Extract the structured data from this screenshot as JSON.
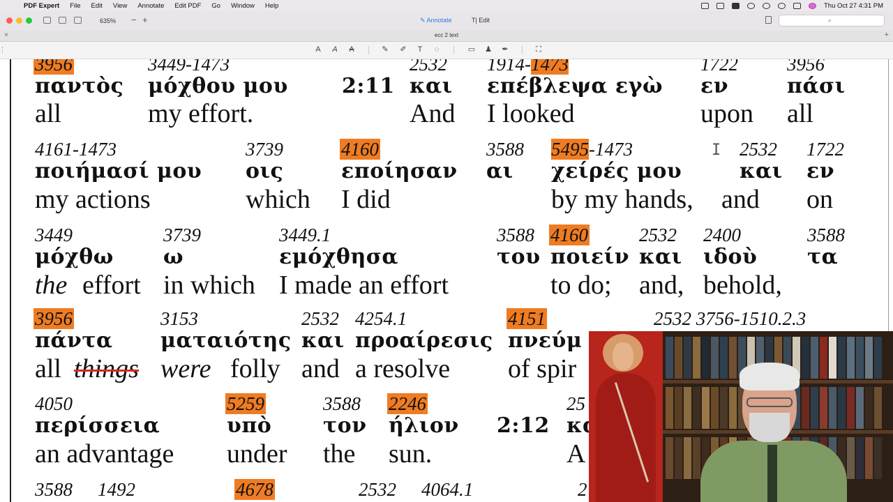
{
  "menubar": {
    "app": "PDF Expert",
    "menus": [
      "File",
      "Edit",
      "View",
      "Annotate",
      "Edit PDF",
      "Go",
      "Window",
      "Help"
    ],
    "clock": "Thu Oct 27  4:31 PM",
    "status_icons": [
      "camera-icon",
      "display-icon",
      "keyboard-us-icon",
      "bluetooth-icon",
      "wifi-icon",
      "search-icon",
      "toggle-icon",
      "siri-icon"
    ]
  },
  "titlebar": {
    "zoom": "635%",
    "zoom_minus": "−",
    "zoom_plus": "+",
    "annotate_label": "Annotate",
    "edit_label": "Edit",
    "search_placeholder": ""
  },
  "tab": {
    "title": "ecc 2 text",
    "close": "×",
    "add": "+"
  },
  "toolbar": {
    "tools": [
      "text-style-icon",
      "text-underline-icon",
      "text-strike-icon",
      "pen-icon",
      "highlighter-icon",
      "text-tool-icon",
      "shapes-icon",
      "comment-icon",
      "stamp-icon",
      "signature-icon",
      "crop-icon"
    ]
  },
  "colors": {
    "highlight": "#ef7c22",
    "strike": "#d62a21",
    "accent": "#2f7ae5"
  },
  "lines": [
    {
      "words": [
        {
          "num": "3956",
          "hl": true,
          "gk": "παντὸς",
          "en": "all"
        },
        {
          "num": "3449-1473",
          "gk": "μόχθου μου",
          "en": "my effort."
        },
        {
          "num": "",
          "gk": "2:11",
          "en": ""
        },
        {
          "num": "2532",
          "gk": "και",
          "en": "And"
        },
        {
          "num": "1914-",
          "num2": "1473",
          "gk": "επέβλεψα εγὼ",
          "en": "I looked"
        },
        {
          "num": "1722",
          "gk": "εν",
          "en": "upon"
        },
        {
          "num": "3956",
          "gk": "πάσι",
          "en": "all"
        }
      ]
    },
    {
      "words": [
        {
          "num": "4161-1473",
          "gk": "ποιήμασί μου",
          "en": "my actions"
        },
        {
          "num": "3739",
          "gk": "οις",
          "en": "which"
        },
        {
          "num": "4160",
          "hl": true,
          "gk": "εποίησαν",
          "en": "I did"
        },
        {
          "num": "3588",
          "gk": "αι",
          "en": ""
        },
        {
          "num": "5495",
          "num2": "-1473",
          "gk": "χείρές μου",
          "en": "by my hands,"
        },
        {
          "num": "2532",
          "gk": "και",
          "en": "and"
        },
        {
          "num": "1722",
          "gk": "εν",
          "en": "on"
        }
      ]
    },
    {
      "words": [
        {
          "num": "3449",
          "gk": "μόχθω",
          "en": "the"
        },
        {
          "num": "",
          "gk": "",
          "en": "effort"
        },
        {
          "num": "3739",
          "gk": "ω",
          "en": "in which"
        },
        {
          "num": "3449.1",
          "gk": "εμόχθησα",
          "en": "I made an effort"
        },
        {
          "num": "3588",
          "gk": "του",
          "en": ""
        },
        {
          "num": "4160",
          "hl": true,
          "gk": "ποιείν",
          "en": "to do;"
        },
        {
          "num": "2532",
          "gk": "και",
          "en": "and,"
        },
        {
          "num": "2400",
          "gk": "ιδοὺ",
          "en": "behold,"
        },
        {
          "num": "3588",
          "gk": "τα",
          "en": ""
        }
      ]
    },
    {
      "words": [
        {
          "num": "3956",
          "hl": true,
          "gk": "πάντα",
          "en": "all"
        },
        {
          "num": "",
          "gk": "",
          "en": "things"
        },
        {
          "num": "3153",
          "gk": "ματαιότης",
          "en": "were"
        },
        {
          "num": "",
          "gk": "",
          "en": "folly"
        },
        {
          "num": "2532",
          "gk": "και",
          "en": "and"
        },
        {
          "num": "4254.1",
          "gk": "προαίρεσις",
          "en": "a resolve"
        },
        {
          "num": "4151",
          "hl": true,
          "gk": "πνεύμ",
          "en": "of spir"
        },
        {
          "num": "2532 3756-1510.2.3",
          "gk": "",
          "en": ""
        }
      ]
    },
    {
      "words": [
        {
          "num": "4050",
          "gk": "περίσσεια",
          "en": "an advantage"
        },
        {
          "num": "5259",
          "hl": true,
          "gk": "υπὸ",
          "en": "under"
        },
        {
          "num": "3588",
          "gk": "τον",
          "en": "the"
        },
        {
          "num": "2246",
          "hl": true,
          "gk": "ήλιον",
          "en": "sun."
        },
        {
          "num": "",
          "gk": "2:12",
          "en": ""
        },
        {
          "num": "25",
          "gk": "κα",
          "en": "A"
        }
      ]
    },
    {
      "words": [
        {
          "num": "3588",
          "gk": "",
          "en": ""
        },
        {
          "num": "1492",
          "gk": "",
          "en": ""
        },
        {
          "num": "4678",
          "hl": true,
          "gk": "",
          "en": ""
        },
        {
          "num": "2532",
          "gk": "",
          "en": ""
        },
        {
          "num": "4064.1",
          "gk": "",
          "en": ""
        },
        {
          "num": "2",
          "gk": "",
          "en": ""
        }
      ]
    }
  ]
}
